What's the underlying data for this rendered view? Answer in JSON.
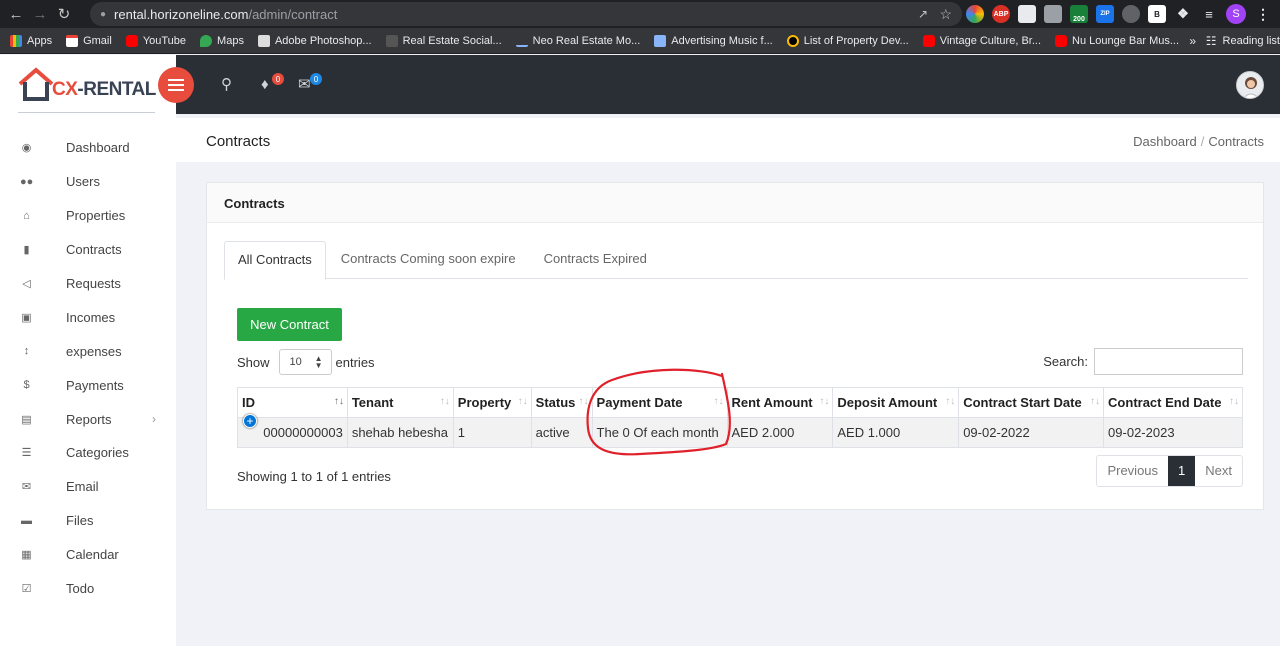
{
  "browser": {
    "url_host": "rental.horizoneline.com",
    "url_path": "/admin/contract",
    "profile_initial": "S",
    "ext_badge": "200",
    "bookmarks": [
      "Apps",
      "Gmail",
      "YouTube",
      "Maps",
      "Adobe Photoshop...",
      "Real Estate Social...",
      "Neo Real Estate Mo...",
      "Advertising Music f...",
      "List of Property Dev...",
      "Vintage Culture, Br...",
      "Nu Lounge Bar Mus..."
    ],
    "bookmarks_more": "»",
    "reading_list": "Reading list"
  },
  "app": {
    "logo_prefix": "CX",
    "logo_suffix": "-RENTAL",
    "notif_count": "0",
    "mail_count": "0"
  },
  "sidebar": {
    "items": [
      {
        "label": "Dashboard",
        "icon": "dashboard-icon"
      },
      {
        "label": "Users",
        "icon": "users-icon"
      },
      {
        "label": "Properties",
        "icon": "home-icon"
      },
      {
        "label": "Contracts",
        "icon": "book-icon"
      },
      {
        "label": "Requests",
        "icon": "megaphone-icon"
      },
      {
        "label": "Incomes",
        "icon": "money-icon"
      },
      {
        "label": "expenses",
        "icon": "sort-icon"
      },
      {
        "label": "Payments",
        "icon": "dollar-icon"
      },
      {
        "label": "Reports",
        "icon": "inbox-icon"
      },
      {
        "label": "Categories",
        "icon": "list-icon"
      },
      {
        "label": "Email",
        "icon": "envelope-icon"
      },
      {
        "label": "Files",
        "icon": "folder-icon"
      },
      {
        "label": "Calendar",
        "icon": "calendar-icon"
      },
      {
        "label": "Todo",
        "icon": "check-square-icon"
      }
    ]
  },
  "titlebar": {
    "title": "Contracts",
    "crumb_home": "Dashboard",
    "crumb_sep": "/",
    "crumb_current": "Contracts"
  },
  "card": {
    "title": "Contracts",
    "tabs": [
      "All Contracts",
      "Contracts Coming soon expire",
      "Contracts Expired"
    ],
    "new_button": "New Contract",
    "show_label": "Show",
    "page_length": "10",
    "entries_label": "entries",
    "search_label": "Search:",
    "info": "Showing 1 to 1 of 1 entries",
    "prev": "Previous",
    "page": "1",
    "next": "Next"
  },
  "table": {
    "headers": [
      "ID",
      "Tenant",
      "Property",
      "Status",
      "Payment Date",
      "Rent Amount",
      "Deposit Amount",
      "Contract Start Date",
      "Contract End Date"
    ],
    "rows": [
      [
        "00000000003",
        "shehab hebesha",
        "1",
        "active",
        "The 0 Of each month",
        "AED 2.000",
        "AED 1.000",
        "09-02-2022",
        "09-02-2023"
      ]
    ]
  },
  "colors": {
    "accent_red": "#e74c3c",
    "header_dark": "#2a2f36",
    "button_green": "#28a745",
    "annotation_red": "#e0202a"
  }
}
